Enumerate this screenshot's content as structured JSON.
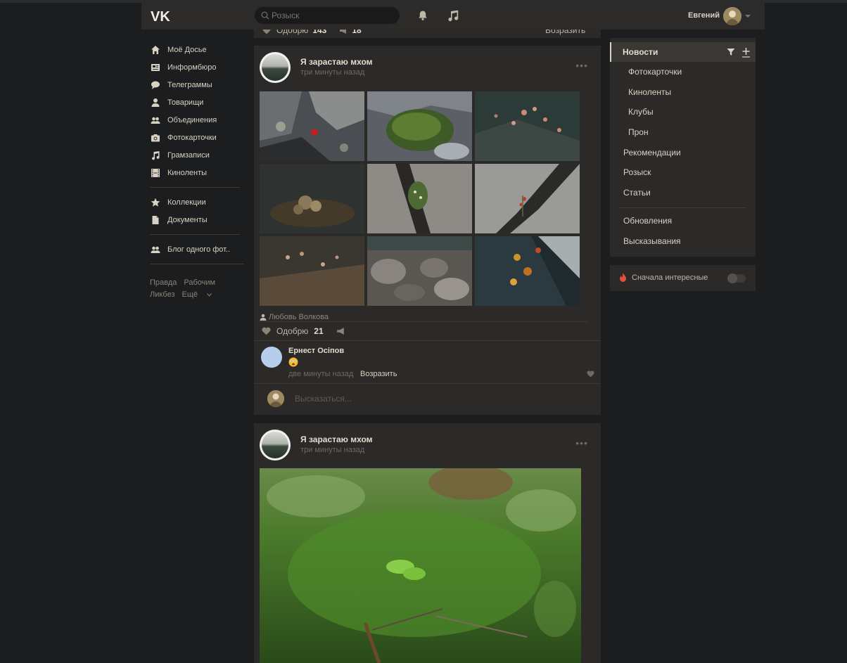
{
  "header": {
    "logo": "VK",
    "search_placeholder": "Розыск",
    "username": "Евгений"
  },
  "stub": {
    "like_label": "Одобрю",
    "like_count": "143",
    "share_count": "18",
    "reply_label": "Возразить"
  },
  "leftnav": {
    "items": [
      {
        "label": "Моё Досье",
        "icon": "home-icon"
      },
      {
        "label": "Информбюро",
        "icon": "news-icon"
      },
      {
        "label": "Телеграммы",
        "icon": "chat-bubble-icon"
      },
      {
        "label": "Товарищи",
        "icon": "user-icon"
      },
      {
        "label": "Объединения",
        "icon": "group-icon"
      },
      {
        "label": "Фотокарточки",
        "icon": "camera-icon"
      },
      {
        "label": "Грамзаписи",
        "icon": "music-note-icon"
      },
      {
        "label": "Киноленты",
        "icon": "film-icon"
      }
    ],
    "items2": [
      {
        "label": "Коллекции",
        "icon": "star-icon"
      },
      {
        "label": "Документы",
        "icon": "document-icon"
      }
    ],
    "items3": [
      {
        "label": "Блог одного фот..",
        "icon": "group-icon"
      }
    ],
    "footer": {
      "l1": "Правда",
      "l2": "Рабочим",
      "l3": "Ликбез",
      "l4": "Ещё"
    }
  },
  "post1": {
    "title": "Я зарастаю мхом",
    "time": "три минуты назад",
    "author": "Любовь Волкова",
    "like_label": "Одобрю",
    "like_count": "21",
    "comment": {
      "name": "Ернест Осiпов",
      "time": "две минуты назад",
      "reply": "Возразить"
    },
    "write_placeholder": "Высказаться..."
  },
  "post2": {
    "title": "Я зарастаю мхом",
    "time": "три минуты назад"
  },
  "rightnav": {
    "active": "Новости",
    "sub": [
      "Фотокарточки",
      "Киноленты",
      "Клубы",
      "Прон"
    ],
    "items": [
      "Рекомендации",
      "Розыск",
      "Статьи"
    ],
    "items2": [
      "Обновления",
      "Высказывания"
    ],
    "toggle_label": "Сначала интересные"
  }
}
